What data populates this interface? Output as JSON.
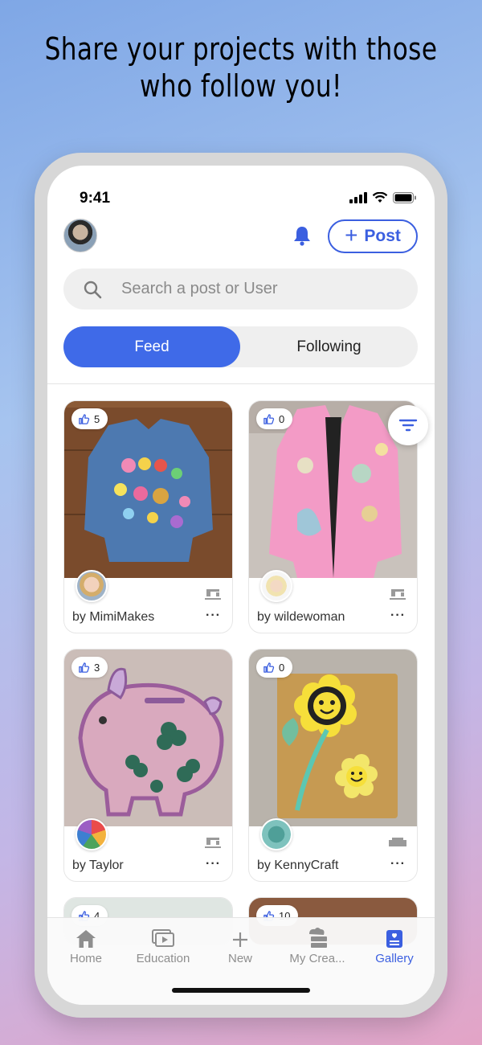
{
  "headline": "Share your projects with those who follow you!",
  "status": {
    "time": "9:41"
  },
  "header": {
    "post_label": "Post"
  },
  "search": {
    "placeholder": "Search a post or User"
  },
  "segments": {
    "feed": "Feed",
    "following": "Following"
  },
  "cards": [
    {
      "likes": "5",
      "author": "by MimiMakes",
      "image": "denim jacket with colorful patches"
    },
    {
      "likes": "0",
      "author": "by wildewoman",
      "image": "pink painted jacket"
    },
    {
      "likes": "3",
      "author": "by Taylor",
      "image": "pink felt piggy bank"
    },
    {
      "likes": "0",
      "author": "by KennyCraft",
      "image": "sunflower paper card"
    },
    {
      "likes": "4"
    },
    {
      "likes": "10"
    }
  ],
  "more_label": "···",
  "tabbar": {
    "items": [
      {
        "label": "Home",
        "icon": "home-icon"
      },
      {
        "label": "Education",
        "icon": "video-icon"
      },
      {
        "label": "New",
        "icon": "plus-icon"
      },
      {
        "label": "My Crea...",
        "icon": "creations-icon"
      },
      {
        "label": "Gallery",
        "icon": "gallery-icon"
      }
    ],
    "active": "Gallery"
  },
  "colors": {
    "accent": "#3f6ae8",
    "active_tab": "#3b5fe0"
  }
}
